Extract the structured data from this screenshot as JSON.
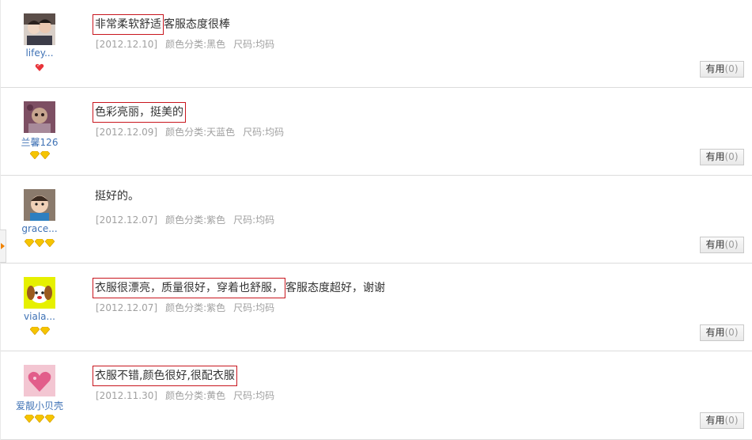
{
  "reviews": [
    {
      "user": "lifey...",
      "badge": "heart",
      "badge_count": 1,
      "highlight": "非常柔软舒适",
      "text": "客服态度很棒",
      "date": "[2012.12.10]",
      "color": "颜色分类:黑色",
      "size": "尺码:均码",
      "useful_label": "有用",
      "useful_count": "(0)"
    },
    {
      "user": "兰馨126",
      "badge": "diamond",
      "badge_count": 2,
      "highlight": "色彩亮丽，挺美的",
      "text": "",
      "date": "[2012.12.09]",
      "color": "颜色分类:天蓝色",
      "size": "尺码:均码",
      "useful_label": "有用",
      "useful_count": "(0)"
    },
    {
      "user": "grace...",
      "badge": "diamond",
      "badge_count": 3,
      "highlight": "",
      "text": "挺好的。",
      "date": "[2012.12.07]",
      "color": "颜色分类:紫色",
      "size": "尺码:均码",
      "useful_label": "有用",
      "useful_count": "(0)"
    },
    {
      "user": "viala...",
      "badge": "diamond",
      "badge_count": 2,
      "highlight": "衣服很漂亮，质量很好，穿着也舒服，",
      "text": "客服态度超好，谢谢",
      "date": "[2012.12.07]",
      "color": "颜色分类:紫色",
      "size": "尺码:均码",
      "useful_label": "有用",
      "useful_count": "(0)"
    },
    {
      "user": "爱靓小贝壳",
      "badge": "diamond",
      "badge_count": 3,
      "highlight": "衣服不错,颜色很好,很配衣服",
      "text": "",
      "date": "[2012.11.30]",
      "color": "颜色分类:黄色",
      "size": "尺码:均码",
      "useful_label": "有用",
      "useful_count": "(0)"
    }
  ],
  "colors": {
    "link": "#3f72b5",
    "highlight_border": "#c8161e",
    "meta_text": "#a0a0a0",
    "diamond": "#f5c400",
    "heart": "#e8343a",
    "side_arrow": "#f08300"
  }
}
